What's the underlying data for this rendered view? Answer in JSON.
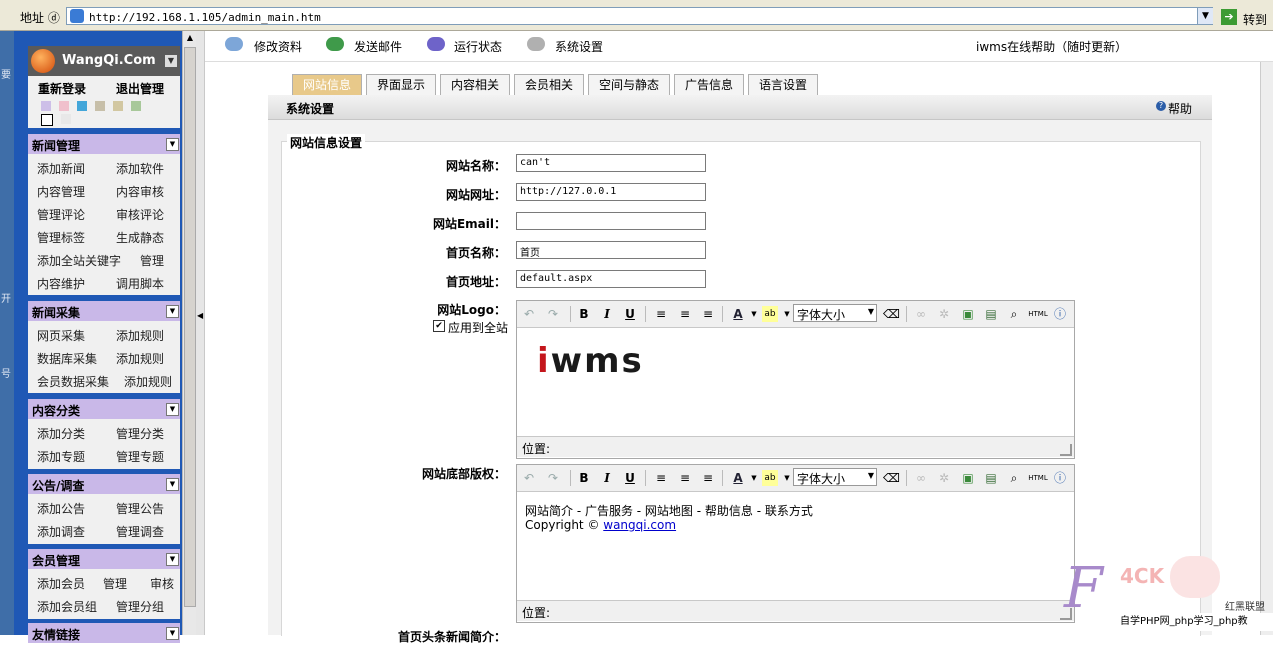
{
  "addressbar": {
    "label": "地址 ⓓ",
    "url": "http://192.168.1.105/admin_main.htm",
    "go_label": "转到"
  },
  "left_strip": [
    "要",
    "开",
    "号"
  ],
  "sidebar": {
    "logo_text": "WangQi.Com",
    "top_links": [
      "重新登录",
      "退出管理"
    ],
    "swatch_colors": [
      "#cdbfe8",
      "#f0c0cc",
      "#43a6d9",
      "#c7bfa9",
      "#d2c7a1",
      "#a8c89a",
      "#000000",
      "#e8e8e8"
    ],
    "sections": [
      {
        "title": "新闻管理",
        "items": [
          "添加新闻",
          "添加软件",
          "内容管理",
          "内容审核",
          "管理评论",
          "审核评论",
          "管理标签",
          "生成静态",
          "添加全站关键字",
          "管理",
          "内容维护",
          "调用脚本"
        ]
      },
      {
        "title": "新闻采集",
        "items": [
          "网页采集",
          "添加规则",
          "数据库采集",
          "添加规则",
          "会员数据采集",
          "添加规则"
        ]
      },
      {
        "title": "内容分类",
        "items": [
          "添加分类",
          "管理分类",
          "添加专题",
          "管理专题"
        ]
      },
      {
        "title": "公告/调查",
        "items": [
          "添加公告",
          "管理公告",
          "添加调查",
          "管理调查"
        ]
      },
      {
        "title": "会员管理",
        "items": [
          "添加会员",
          "管理",
          "审核",
          "添加会员组",
          "管理分组"
        ]
      },
      {
        "title": "友情链接",
        "items": []
      }
    ]
  },
  "toolbar": {
    "items": [
      "修改资料",
      "发送邮件",
      "运行状态",
      "系统设置"
    ],
    "right_text": "iwms在线帮助（随时更新）"
  },
  "tabs": [
    "网站信息",
    "界面显示",
    "内容相关",
    "会员相关",
    "空间与静态",
    "广告信息",
    "语言设置"
  ],
  "section_title": "系统设置",
  "help_label": "帮助",
  "legend": "网站信息设置",
  "fields": [
    {
      "label": "网站名称：",
      "value": "can't"
    },
    {
      "label": "网站网址：",
      "value": "http://127.0.0.1"
    },
    {
      "label": "网站Email：",
      "value": ""
    },
    {
      "label": "首页名称：",
      "value": "首页"
    },
    {
      "label": "首页地址：",
      "value": "default.aspx"
    }
  ],
  "logo_field": {
    "label": "网站Logo：",
    "checkbox_label": "应用到全站",
    "checked": true,
    "logo_text": "iwms"
  },
  "editor": {
    "font_size_label": "字体大小",
    "status_label": "位置:"
  },
  "footer_field": {
    "label": "网站底部版权：",
    "line1": "网站简介 - 广告服务 - 网站地图 - 帮助信息 - 联系方式",
    "line2_prefix": "Copyright © ",
    "line2_link": "wangqi.com"
  },
  "next_label": "首页头条新闻简介：",
  "watermark": {
    "text": "4CK",
    "sub": "自学PHP网_php学习_php教",
    "tag": "红黑联盟"
  }
}
